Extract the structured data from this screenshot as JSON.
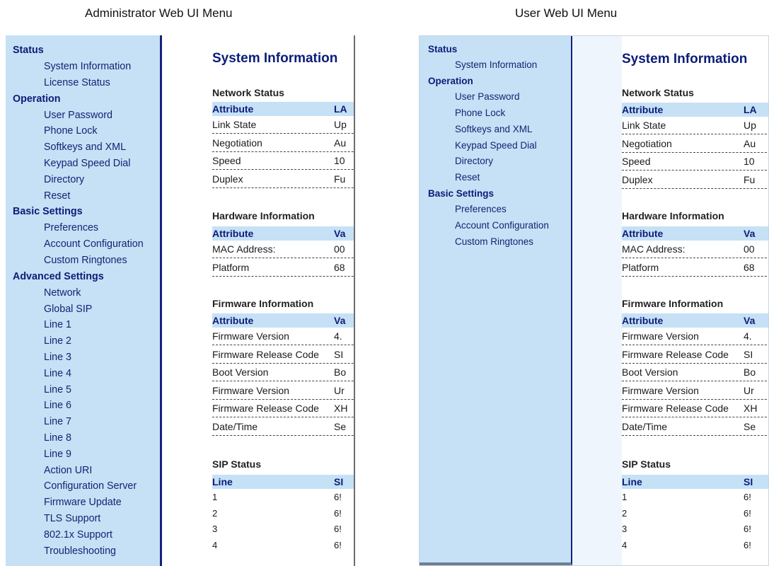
{
  "captions": {
    "left": "Administrator Web UI Menu",
    "right": "User Web UI Menu"
  },
  "admin_menu": [
    {
      "label": "Status",
      "type": "section"
    },
    {
      "label": "System Information",
      "type": "item"
    },
    {
      "label": "License Status",
      "type": "item"
    },
    {
      "label": "Operation",
      "type": "section"
    },
    {
      "label": "User Password",
      "type": "item"
    },
    {
      "label": "Phone Lock",
      "type": "item"
    },
    {
      "label": "Softkeys and XML",
      "type": "item"
    },
    {
      "label": "Keypad Speed Dial",
      "type": "item"
    },
    {
      "label": "Directory",
      "type": "item"
    },
    {
      "label": "Reset",
      "type": "item"
    },
    {
      "label": "Basic Settings",
      "type": "section"
    },
    {
      "label": "Preferences",
      "type": "item"
    },
    {
      "label": "Account Configuration",
      "type": "item"
    },
    {
      "label": "Custom Ringtones",
      "type": "item"
    },
    {
      "label": "Advanced Settings",
      "type": "section"
    },
    {
      "label": "Network",
      "type": "item"
    },
    {
      "label": "Global SIP",
      "type": "item"
    },
    {
      "label": "Line 1",
      "type": "item"
    },
    {
      "label": "Line 2",
      "type": "item"
    },
    {
      "label": "Line 3",
      "type": "item"
    },
    {
      "label": "Line 4",
      "type": "item"
    },
    {
      "label": "Line 5",
      "type": "item"
    },
    {
      "label": "Line 6",
      "type": "item"
    },
    {
      "label": "Line 7",
      "type": "item"
    },
    {
      "label": "Line 8",
      "type": "item"
    },
    {
      "label": "Line 9",
      "type": "item"
    },
    {
      "label": "Action URI",
      "type": "item"
    },
    {
      "label": "Configuration Server",
      "type": "item"
    },
    {
      "label": "Firmware Update",
      "type": "item"
    },
    {
      "label": "TLS Support",
      "type": "item"
    },
    {
      "label": "802.1x Support",
      "type": "item"
    },
    {
      "label": "Troubleshooting",
      "type": "item"
    }
  ],
  "user_menu": [
    {
      "label": "Status",
      "type": "section"
    },
    {
      "label": "System Information",
      "type": "item"
    },
    {
      "label": "Operation",
      "type": "section"
    },
    {
      "label": "User Password",
      "type": "item"
    },
    {
      "label": "Phone Lock",
      "type": "item"
    },
    {
      "label": "Softkeys and XML",
      "type": "item"
    },
    {
      "label": "Keypad Speed Dial",
      "type": "item"
    },
    {
      "label": "Directory",
      "type": "item"
    },
    {
      "label": "Reset",
      "type": "item"
    },
    {
      "label": "Basic Settings",
      "type": "section"
    },
    {
      "label": "Preferences",
      "type": "item"
    },
    {
      "label": "Account Configuration",
      "type": "item"
    },
    {
      "label": "Custom Ringtones",
      "type": "item"
    }
  ],
  "content": {
    "page_title": "System Information",
    "sections": [
      {
        "title": "Network Status",
        "header": [
          "Attribute",
          "LA"
        ],
        "rows": [
          [
            "Link State",
            "Up"
          ],
          [
            "Negotiation",
            "Au"
          ],
          [
            "Speed",
            "10"
          ],
          [
            "Duplex",
            "Fu"
          ]
        ]
      },
      {
        "title": "Hardware Information",
        "header": [
          "Attribute",
          "Va"
        ],
        "rows": [
          [
            "MAC Address:",
            "00"
          ],
          [
            "Platform",
            "68"
          ]
        ]
      },
      {
        "title": "Firmware Information",
        "header": [
          "Attribute",
          "Va"
        ],
        "rows": [
          [
            "Firmware Version",
            "4."
          ],
          [
            "Firmware Release Code",
            "SI"
          ],
          [
            "Boot Version",
            "Bo"
          ],
          [
            "Firmware Version",
            "Ur"
          ],
          [
            "Firmware Release Code",
            "XH"
          ],
          [
            "Date/Time",
            "Se"
          ]
        ]
      },
      {
        "title": "SIP Status",
        "header": [
          "Line",
          "SI"
        ],
        "rows": [
          [
            "1",
            "6!"
          ],
          [
            "2",
            "6!"
          ],
          [
            "3",
            "6!"
          ],
          [
            "4",
            "6!"
          ]
        ],
        "plain": true
      }
    ]
  }
}
